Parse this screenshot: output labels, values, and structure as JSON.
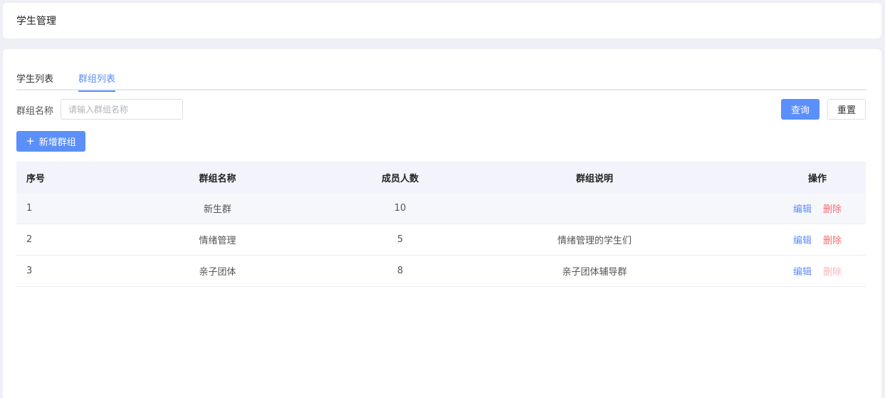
{
  "header": {
    "title": "学生管理"
  },
  "tabs": [
    {
      "label": "学生列表",
      "active": false
    },
    {
      "label": "群组列表",
      "active": true
    }
  ],
  "filter": {
    "label": "群组名称",
    "placeholder": "请输入群组名称",
    "value": "",
    "query_label": "查询",
    "reset_label": "重置"
  },
  "toolbar": {
    "add_label": "新增群组",
    "add_icon": "plus-icon"
  },
  "table": {
    "columns": [
      "序号",
      "群组名称",
      "成员人数",
      "群组说明",
      "操作"
    ],
    "rows": [
      {
        "idx": "1",
        "name": "新生群",
        "count": "10",
        "desc": "",
        "edit": "编辑",
        "delete": "删除"
      },
      {
        "idx": "2",
        "name": "情绪管理",
        "count": "5",
        "desc": "情绪管理的学生们",
        "edit": "编辑",
        "delete": "删除"
      },
      {
        "idx": "3",
        "name": "亲子团体",
        "count": "8",
        "desc": "亲子团体辅导群",
        "edit": "编辑",
        "delete": "删除"
      }
    ]
  },
  "colors": {
    "primary": "#5b8ff9",
    "danger": "#f56c6c",
    "header_bg": "#f2f3fb"
  }
}
